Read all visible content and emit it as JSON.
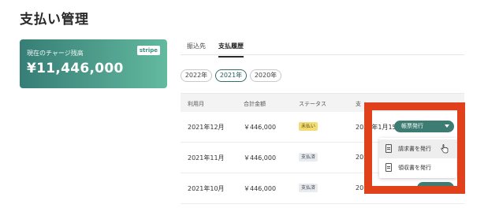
{
  "page": {
    "title": "支払い管理"
  },
  "balance": {
    "label": "現在のチャージ残高",
    "amount": "¥11,446,000",
    "badge": "stripe"
  },
  "tabs": [
    {
      "label": "振込先",
      "active": false
    },
    {
      "label": "支払履歴",
      "active": true
    }
  ],
  "years": [
    {
      "label": "2022年",
      "active": false
    },
    {
      "label": "2021年",
      "active": true
    },
    {
      "label": "2020年",
      "active": false
    }
  ],
  "table": {
    "headers": [
      "利用月",
      "合計金額",
      "ステータス",
      "支"
    ],
    "rows": [
      {
        "month": "2021年12月",
        "amount": "￥446,000",
        "status": "未払い",
        "date": "2022年1月15日",
        "action": "帳票発行"
      },
      {
        "month": "2021年11月",
        "amount": "￥446,000",
        "status": "支払済",
        "date": "20",
        "action": ""
      },
      {
        "month": "2021年10月",
        "amount": "￥446,000",
        "status": "支払済",
        "date": "20",
        "action": ""
      }
    ]
  },
  "dropdown": {
    "items": [
      {
        "label": "請求書を発行",
        "icon": "document-icon"
      },
      {
        "label": "領収書を発行",
        "icon": "document-icon"
      }
    ]
  },
  "colors": {
    "accent": "#3c7c72",
    "highlight": "#e0401a",
    "unpaid_badge": "#f3dc74"
  }
}
